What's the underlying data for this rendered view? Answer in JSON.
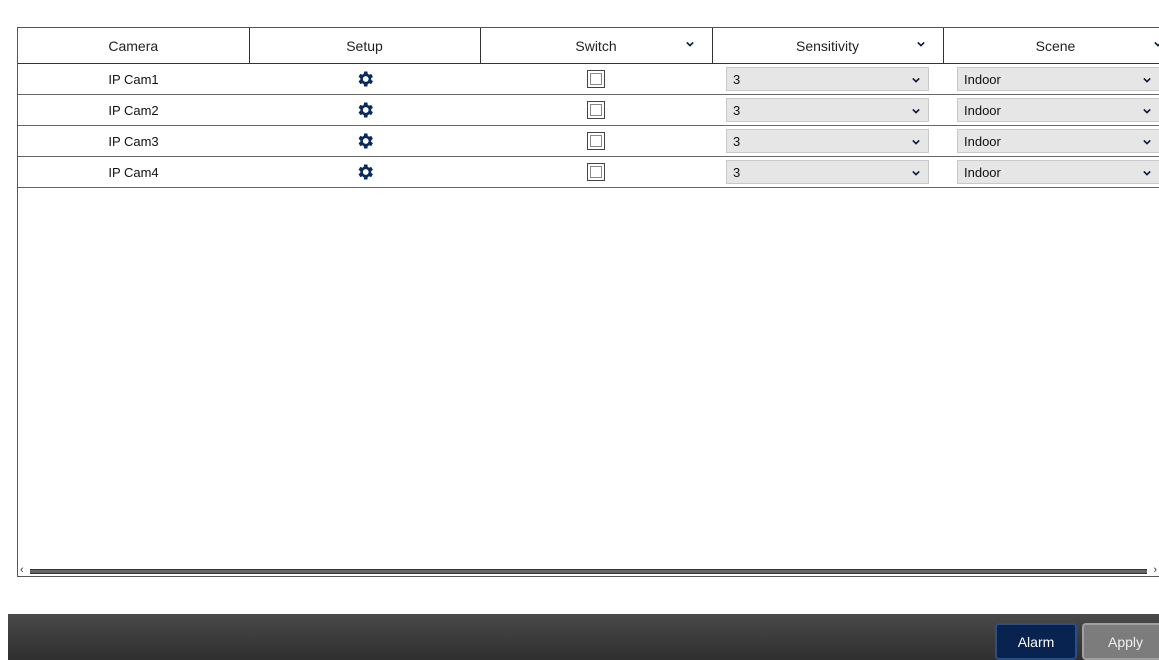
{
  "table": {
    "columns": [
      {
        "label": "Camera",
        "has_dropdown": false
      },
      {
        "label": "Setup",
        "has_dropdown": false
      },
      {
        "label": "Switch",
        "has_dropdown": true
      },
      {
        "label": "Sensitivity",
        "has_dropdown": true
      },
      {
        "label": "Scene",
        "has_dropdown": true
      }
    ],
    "rows": [
      {
        "camera": "IP Cam1",
        "setup_icon": "gear-icon",
        "switch_checked": false,
        "sensitivity": "3",
        "scene": "Indoor"
      },
      {
        "camera": "IP Cam2",
        "setup_icon": "gear-icon",
        "switch_checked": false,
        "sensitivity": "3",
        "scene": "Indoor"
      },
      {
        "camera": "IP Cam3",
        "setup_icon": "gear-icon",
        "switch_checked": false,
        "sensitivity": "3",
        "scene": "Indoor"
      },
      {
        "camera": "IP Cam4",
        "setup_icon": "gear-icon",
        "switch_checked": false,
        "sensitivity": "3",
        "scene": "Indoor"
      }
    ]
  },
  "footer": {
    "alarm_label": "Alarm",
    "apply_label": "Apply"
  },
  "colors": {
    "gear_icon": "#0a2a5e",
    "alarm_button": "#08234f",
    "apply_button": "#7c7c7c",
    "footer_bar": "#3a3a3a"
  }
}
